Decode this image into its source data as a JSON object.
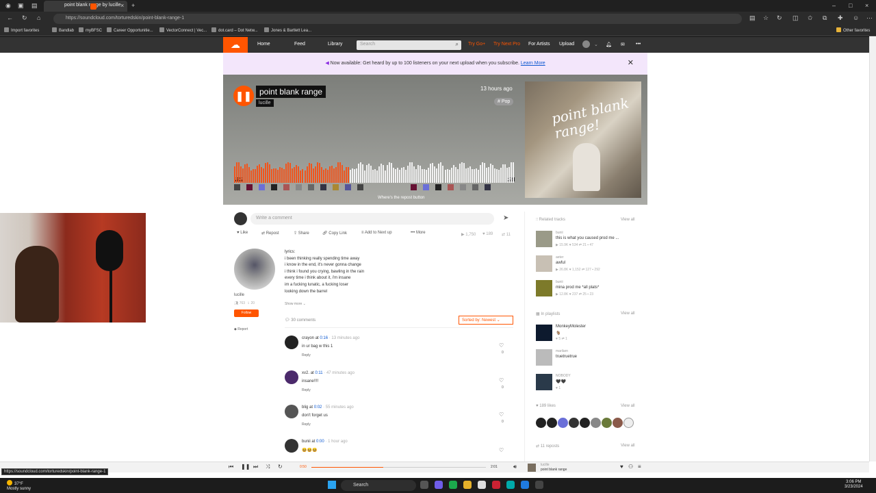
{
  "browser": {
    "tab_title": "point blank range by lucille",
    "url": "https://soundcloud.com/torturedskin/point-blank-range-1",
    "bookmarks": [
      "Import favorites",
      "Bandlab",
      "myBFSC",
      "Career Opportunitie...",
      "VectorConnect | Vec...",
      "dot.card – Dot Netw...",
      "Jones & Bartlett Lea...",
      "Other favorites"
    ]
  },
  "sc_nav": {
    "home": "Home",
    "feed": "Feed",
    "library": "Library",
    "search_placeholder": "Search",
    "try_go": "Try Go+",
    "try_next_pro": "Try Next Pro",
    "for_artists": "For Artists",
    "upload": "Upload"
  },
  "banner": {
    "text": "Now available: Get heard by up to 100 listeners on your next upload when you subscribe.",
    "link": "Learn More"
  },
  "track": {
    "title": "point blank range",
    "artist": "lucille",
    "time_ago": "13 hours ago",
    "genre": "# Pop",
    "artwork_text": "point blank range!",
    "current_time": "0:50",
    "duration": "2:01",
    "progress": 0.41,
    "repost_note": "Where's the repost button"
  },
  "comment_input": {
    "placeholder": "Write a comment"
  },
  "actions": {
    "like": "Like",
    "repost": "Repost",
    "share": "Share",
    "copy_link": "Copy Link",
    "add_to_next_up": "Add to Next up",
    "more": "More",
    "plays": "1,750",
    "likes": "189",
    "reposts": "11"
  },
  "artist_card": {
    "name": "lucille",
    "followers": "763",
    "tracks": "20",
    "follow": "Follow",
    "report": "Report"
  },
  "description": {
    "lines": [
      "lyrics:",
      "i been thinking really spending time away",
      "i know in the end, it's never gonna change",
      "i think i found you crying, bawling in the rain",
      "every time i think about it, i'm insane",
      "im a fucking lunatic, a fucking loser",
      "looking down the barrel"
    ],
    "show_more": "Show more"
  },
  "comments_header": {
    "count": "30 comments",
    "sort": "Sorted by: Newest"
  },
  "comments": [
    {
      "user": "crayon",
      "at": "at",
      "ts": "0:16",
      "ago": "13 minutes ago",
      "text": "in ur bag w this 1",
      "reply": "Reply",
      "likes": "0",
      "color": "#222222"
    },
    {
      "user": "xv2.",
      "at": "at",
      "ts": "0:11",
      "ago": "47 minutes ago",
      "text": "insane!!!!",
      "reply": "Reply",
      "likes": "0",
      "color": "#4b2a6b"
    },
    {
      "user": "blig",
      "at": "at",
      "ts": "0:02",
      "ago": "55 minutes ago",
      "text": "don't forget us",
      "reply": "Reply",
      "likes": "0",
      "color": "#555555"
    },
    {
      "user": "bunii",
      "at": "at",
      "ts": "0:00",
      "ago": "1 hour ago",
      "text": "😆😆😆",
      "reply": "",
      "likes": "",
      "color": "#333333"
    }
  ],
  "sidebar": {
    "related_header": "Related tracks",
    "view_all": "View all",
    "related": [
      {
        "artist": "bunii",
        "title": "this is what you caused prod me ...",
        "stats": "▶ 15.9K  ♥ 534  ⇄ 21  ▪ 47",
        "color": "#9a9a88"
      },
      {
        "artist": "aeter",
        "title": "awful",
        "stats": "▶ 26.8K  ♥ 1,152  ⇄ 127  ▪ 292",
        "color": "#c8c0b4"
      },
      {
        "artist": "bunii",
        "title": "mina prod me *all plats*",
        "stats": "▶ 12.8K  ♥ 237  ⇄ 25  ▪ 23",
        "color": "#7d7a2a"
      }
    ],
    "playlists_header": "In playlists",
    "playlists": [
      {
        "artist": "MonkeyMolester",
        "title": "🐐",
        "stats": "♥ 5  ⇄ 1",
        "color": "#0d1a2e"
      },
      {
        "artist": "marilarn",
        "title": "truetruetrue",
        "stats": "",
        "color": "#bbbbbb"
      },
      {
        "artist": "NOBODY",
        "title": "🖤🖤",
        "stats": "♥ 1",
        "color": "#2a3a4a"
      }
    ],
    "likes_header": "189 likes",
    "reposts_header": "11 reposts"
  },
  "player": {
    "artist": "lucille",
    "title": "point blank range"
  },
  "status_url": "https://soundcloud.com/torturedskin/point-blank-range-1",
  "taskbar": {
    "weather_temp": "37°F",
    "weather_desc": "Mostly sunny",
    "search": "Search",
    "time": "3:06 PM",
    "date": "3/23/2024"
  }
}
